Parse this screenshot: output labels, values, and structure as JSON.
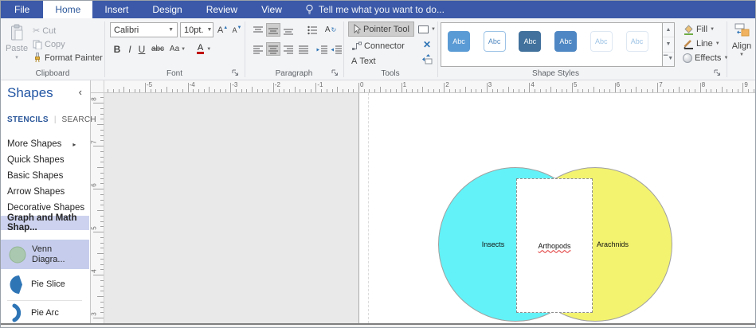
{
  "ribbon": {
    "file": "File",
    "tabs": [
      "Home",
      "Insert",
      "Design",
      "Review",
      "View"
    ],
    "active_tab": "Home",
    "tell_me": "Tell me what you want to do..."
  },
  "groups": {
    "clipboard": {
      "label": "Clipboard",
      "paste": "Paste",
      "cut": "Cut",
      "copy": "Copy",
      "format_painter": "Format Painter"
    },
    "font": {
      "label": "Font",
      "family": "Calibri",
      "size": "10pt.",
      "bold": "B",
      "italic": "I",
      "underline": "U",
      "strike": "abc",
      "case_label": "Aa",
      "color_label": "A"
    },
    "paragraph": {
      "label": "Paragraph"
    },
    "tools": {
      "label": "Tools",
      "pointer": "Pointer Tool",
      "connector": "Connector",
      "text": "Text"
    },
    "shape_styles": {
      "label": "Shape Styles",
      "chips": [
        {
          "label": "Abc",
          "fill": "#5b9bd5",
          "text": "#ffffff",
          "border": "#5b9bd5"
        },
        {
          "label": "Abc",
          "fill": "#ffffff",
          "text": "#4f87c0",
          "border": "#9dc3e6"
        },
        {
          "label": "Abc",
          "fill": "#41719c",
          "text": "#ffffff",
          "border": "#41719c"
        },
        {
          "label": "Abc",
          "fill": "#4e87c3",
          "text": "#ffffff",
          "border": "#4e87c3"
        },
        {
          "label": "Abc",
          "fill": "#ffffff",
          "text": "#9dc3e6",
          "border": "#dee8f3"
        },
        {
          "label": "Abc",
          "fill": "#ffffff",
          "text": "#9dc3e6",
          "border": "#dee8f3"
        }
      ]
    },
    "format": {
      "fill": "Fill",
      "line": "Line",
      "effects": "Effects"
    },
    "align": {
      "label": "Align"
    }
  },
  "rulers": {
    "horizontal_labels": [
      "-5",
      "-4",
      "-3",
      "-2",
      "-1",
      "0",
      "1",
      "2",
      "3",
      "4",
      "5",
      "6",
      "7",
      "8",
      "9"
    ],
    "vertical_labels": [
      "8",
      "7",
      "6",
      "5",
      "4",
      "3"
    ]
  },
  "sidebar": {
    "title": "Shapes",
    "stencils_tab": "STENCILS",
    "search_tab": "SEARCH",
    "nav": [
      {
        "label": "More Shapes",
        "arrow": true
      },
      {
        "label": "Quick Shapes"
      },
      {
        "label": "Basic Shapes"
      },
      {
        "label": "Arrow Shapes"
      },
      {
        "label": "Decorative Shapes"
      },
      {
        "label": "Graph and Math Shap...",
        "active": true
      }
    ],
    "masters": {
      "venn": {
        "line1": "Venn",
        "line2": "Diagra...",
        "icon_color": "#a5c7a5"
      },
      "pie_slice": {
        "label": "Pie Slice",
        "icon_color": "#2e75b6"
      },
      "pie_arc": {
        "label": "Pie Arc",
        "icon_color": "#2e75b6"
      }
    }
  },
  "canvas": {
    "venn": {
      "left_circle": {
        "label": "Insects",
        "fill": "#63f2f7"
      },
      "right_circle": {
        "label": "Arachnids",
        "fill": "#f3f370"
      },
      "intersection": {
        "label": "Arthopods",
        "misspelled": true
      }
    }
  },
  "colors": {
    "accent": "#3b59a8",
    "active_tab_text": "#2b579a",
    "selection_highlight": "#cdd3ee"
  }
}
